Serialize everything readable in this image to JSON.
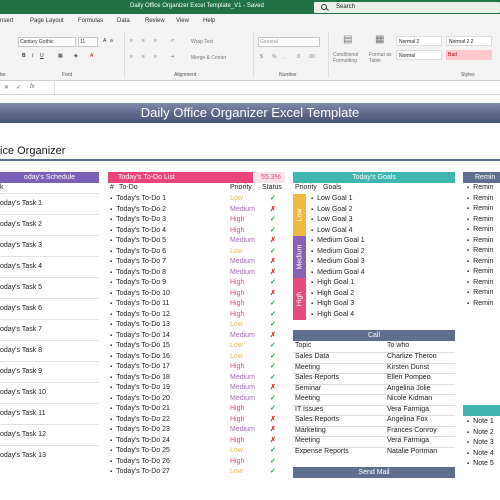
{
  "titlebar": {
    "title": "Daily Office Organizer Excel Template_V1  -  Saved",
    "search": "Search"
  },
  "menu": [
    "nsert",
    "Page Layout",
    "Formulas",
    "Data",
    "Review",
    "View",
    "Help"
  ],
  "ribbon": {
    "font_name": "Century Gothic",
    "font_size": "11",
    "wrap_text": "Wrap Text",
    "merge_center": "Merge & Center",
    "number_format": "General",
    "conditional_formatting": "Conditional Formatting",
    "format_as_table": "Format as Table",
    "groups": {
      "clipboard": "ter",
      "font": "Font",
      "alignment": "Alignment",
      "number": "Number",
      "styles": "Styles"
    },
    "styles": [
      {
        "label": "Normal 2",
        "color": "#ffffff"
      },
      {
        "label": "Normal 2.2",
        "color": "#ffffff"
      },
      {
        "label": "Normal",
        "color": "#ffffff"
      },
      {
        "label": "Bad",
        "color": "#ffc7ce"
      }
    ]
  },
  "sheet": {
    "banner": "Daily Office Organizer Excel Template",
    "section_title": "ice Organizer",
    "schedule": {
      "header": "oday's Schedule",
      "col": "k",
      "color": "#7b60b6",
      "items": [
        "oday's Task 1",
        "oday's Task 2",
        "oday's Task 3",
        "oday's Task 4",
        "oday's Task 5",
        "oday's Task 6",
        "oday's Task 7",
        "oday's Task 8",
        "oday's Task 9",
        "oday's Task 10",
        "oday's Task 11",
        "oday's Task 12",
        "oday's Task 13"
      ]
    },
    "todo": {
      "header": "Today's To-Do List",
      "percent": "55.3%",
      "check": "✓",
      "color": "#e8457a",
      "cols": {
        "num": "#",
        "todo": "To-Do",
        "priority": "Priority",
        "status": "Status"
      },
      "items": [
        {
          "t": "Today's To-Do 1",
          "p": "Low",
          "s": "✓"
        },
        {
          "t": "Today's To-Do 2",
          "p": "Medium",
          "s": "✗"
        },
        {
          "t": "Today's To-Do 3",
          "p": "High",
          "s": "✓"
        },
        {
          "t": "Today's To-Do 4",
          "p": "High",
          "s": "✓"
        },
        {
          "t": "Today's To-Do 5",
          "p": "Medium",
          "s": "✗"
        },
        {
          "t": "Today's To-Do 6",
          "p": "Low",
          "s": "✓"
        },
        {
          "t": "Today's To-Do 7",
          "p": "Medium",
          "s": "✗"
        },
        {
          "t": "Today's To-Do 8",
          "p": "Medium",
          "s": "✗"
        },
        {
          "t": "Today's To-Do 9",
          "p": "High",
          "s": "✓"
        },
        {
          "t": "Today's To-Do 10",
          "p": "High",
          "s": "✗"
        },
        {
          "t": "Today's To-Do 11",
          "p": "High",
          "s": "✓"
        },
        {
          "t": "Today's To-Do 12",
          "p": "High",
          "s": "✓"
        },
        {
          "t": "Today's To-Do 13",
          "p": "Low",
          "s": "✓"
        },
        {
          "t": "Today's To-Do 14",
          "p": "Medium",
          "s": "✗"
        },
        {
          "t": "Today's To-Do 15",
          "p": "Low",
          "s": "✓"
        },
        {
          "t": "Today's To-Do 16",
          "p": "Low",
          "s": "✓"
        },
        {
          "t": "Today's To-Do 17",
          "p": "High",
          "s": "✓"
        },
        {
          "t": "Today's To-Do 18",
          "p": "Medium",
          "s": "✓"
        },
        {
          "t": "Today's To-Do 19",
          "p": "Medium",
          "s": "✗"
        },
        {
          "t": "Today's To-Do 20",
          "p": "Medium",
          "s": "✓"
        },
        {
          "t": "Today's To-Do 21",
          "p": "High",
          "s": "✓"
        },
        {
          "t": "Today's To-Do 22",
          "p": "High",
          "s": "✗"
        },
        {
          "t": "Today's To-Do 23",
          "p": "Medium",
          "s": "✗"
        },
        {
          "t": "Today's To-Do 24",
          "p": "High",
          "s": "✗"
        },
        {
          "t": "Today's To-Do 25",
          "p": "Low",
          "s": "✓"
        },
        {
          "t": "Today's To-Do 26",
          "p": "High",
          "s": "✓"
        },
        {
          "t": "Today's To-Do 27",
          "p": "Low",
          "s": "✓"
        }
      ]
    },
    "goals": {
      "header": "Today's Goals",
      "color": "#3fb6b0",
      "col_priority": "Priority",
      "col_goals": "Goals",
      "groups": [
        {
          "label": "Low",
          "color": "#f0b93e",
          "items": [
            "Low Goal 1",
            "Low Goal 2",
            "Low Goal 3",
            "Low Goal 4"
          ]
        },
        {
          "label": "Medium",
          "color": "#8b5fb8",
          "items": [
            "Medium Goal 1",
            "Medium Goal 2",
            "Medium Goal 3",
            "Medium Goal 4"
          ]
        },
        {
          "label": "High",
          "color": "#e84a7f",
          "items": [
            "High Goal 1",
            "High Goal 2",
            "High Goal 3",
            "High Goal 4"
          ]
        }
      ]
    },
    "call": {
      "header": "Call",
      "color": "#5f6f8e",
      "cols": [
        "Topic",
        "To who"
      ],
      "rows": [
        [
          "Sales Data",
          "Charlize Theron"
        ],
        [
          "Meeting",
          "Kirsten Dunst"
        ],
        [
          "Sales Reports",
          "Ellen Pompeo"
        ],
        [
          "Seminar",
          "Angelina Jolie"
        ],
        [
          "Meeting",
          "Nicole Kidman"
        ],
        [
          "IT Issues",
          "Vera Farmiga"
        ],
        [
          "Sales Reports",
          "Angelina Fox"
        ],
        [
          "Marketing",
          "Frances Conroy"
        ],
        [
          "Meeting",
          "Vera Farmiga"
        ],
        [
          "Expense Reports",
          "Natalie Portman"
        ]
      ]
    },
    "send_mail": {
      "header": "Send Mail",
      "color": "#5f6f8e"
    },
    "reminders": {
      "header": "Remin",
      "color": "#5f6f8e",
      "items": [
        "Remin",
        "Remin",
        "Remin",
        "Remin",
        "Remin",
        "Remin",
        "Remin",
        "Remin",
        "Remin",
        "Remin",
        "Remin",
        "Remin"
      ]
    },
    "notes": {
      "color": "#3fb6b0",
      "items": [
        "Note 1",
        "Note 2",
        "Note 3",
        "Note 4",
        "Note 5"
      ]
    }
  }
}
